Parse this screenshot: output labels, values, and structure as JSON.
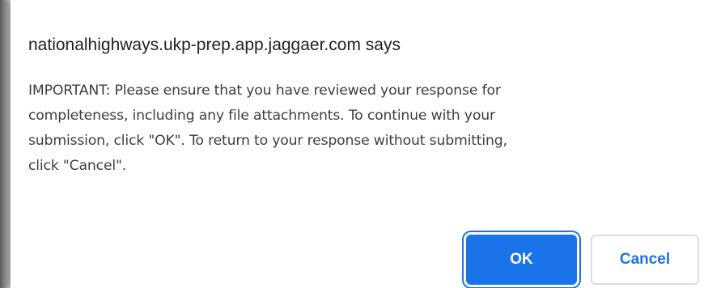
{
  "dialog": {
    "title": "nationalhighways.ukp-prep.app.jaggaer.com says",
    "message_lines": [
      "IMPORTANT:  Please ensure that you have reviewed your response for",
      "completeness, including any file attachments.  To continue with your",
      "submission, click \"OK\".  To return to your response without submitting,",
      "click \"Cancel\"."
    ],
    "ok_label": "OK",
    "cancel_label": "Cancel"
  },
  "colors": {
    "accent": "#1a73e8",
    "title_text": "#202124",
    "body_text": "#3c4043",
    "cancel_border": "#dadce0"
  }
}
